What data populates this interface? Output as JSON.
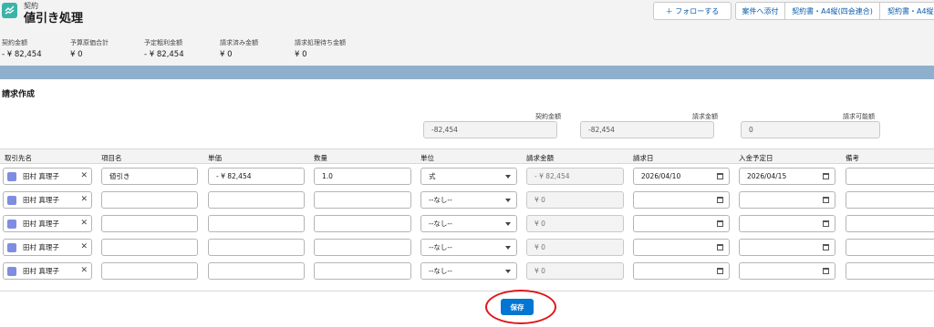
{
  "header": {
    "object_label": "契約",
    "title": "値引き処理",
    "buttons": {
      "follow": "＋ フォローする",
      "attach": "案件へ添付",
      "contract_a4": "契約書・A4縦(四会連合)",
      "contract_a4_2": "契約書・A4縦"
    },
    "highlights": [
      {
        "label": "契約金額",
        "value": "- ¥ 82,454"
      },
      {
        "label": "予算原価合計",
        "value": "¥ 0"
      },
      {
        "label": "予定粗利金額",
        "value": "- ¥ 82,454"
      },
      {
        "label": "請求済み金額",
        "value": "¥ 0"
      },
      {
        "label": "請求処理待ち金額",
        "value": "¥ 0"
      }
    ]
  },
  "section": {
    "title": "請求作成",
    "summary": [
      {
        "label": "契約金額",
        "value": "-82,454"
      },
      {
        "label": "請求金額",
        "value": "-82,454"
      },
      {
        "label": "請求可能額",
        "value": "0"
      }
    ]
  },
  "table": {
    "headers": [
      "取引先名",
      "項目名",
      "単価",
      "数量",
      "単位",
      "請求金額",
      "請求日",
      "入金予定日",
      "備考"
    ],
    "rows": [
      {
        "account": "田村 真理子",
        "item": "値引き",
        "unit_price": "- ¥ 82,454",
        "qty": "1.0",
        "unit": "式",
        "amount": "- ¥ 82,454",
        "bill_date": "2026/04/10",
        "pay_date": "2026/04/15",
        "note": ""
      },
      {
        "account": "田村 真理子",
        "item": "",
        "unit_price": "",
        "qty": "",
        "unit": "--なし--",
        "amount": "¥ 0",
        "bill_date": "",
        "pay_date": "",
        "note": ""
      },
      {
        "account": "田村 真理子",
        "item": "",
        "unit_price": "",
        "qty": "",
        "unit": "--なし--",
        "amount": "¥ 0",
        "bill_date": "",
        "pay_date": "",
        "note": ""
      },
      {
        "account": "田村 真理子",
        "item": "",
        "unit_price": "",
        "qty": "",
        "unit": "--なし--",
        "amount": "¥ 0",
        "bill_date": "",
        "pay_date": "",
        "note": ""
      },
      {
        "account": "田村 真理子",
        "item": "",
        "unit_price": "",
        "qty": "",
        "unit": "--なし--",
        "amount": "¥ 0",
        "bill_date": "",
        "pay_date": "",
        "note": ""
      }
    ],
    "remove_glyph": "✕"
  },
  "footer": {
    "save_label": "保存"
  },
  "colors": {
    "brand": "#0176d3",
    "annotation_ring": "#e0151b",
    "object_icon": "#3bb4a8",
    "contact_icon": "#7f8de1"
  },
  "icons": {
    "object": "contract-icon",
    "contact": "contact-icon",
    "calendar": "calendar-icon",
    "dropdown": "chevron-down-icon",
    "remove": "close-icon"
  }
}
